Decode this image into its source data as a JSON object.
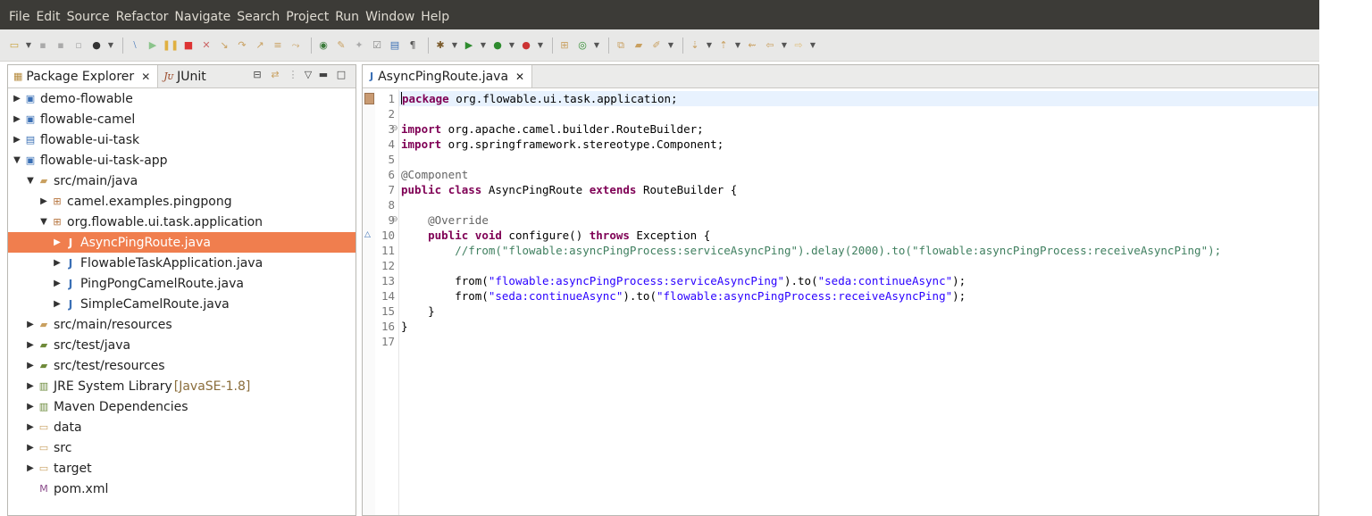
{
  "menu": {
    "items": [
      "File",
      "Edit",
      "Source",
      "Refactor",
      "Navigate",
      "Search",
      "Project",
      "Run",
      "Window",
      "Help"
    ]
  },
  "left_panel": {
    "tabs": [
      {
        "label": "Package Explorer",
        "icon": "package-explorer-icon"
      },
      {
        "label": "JUnit",
        "icon": "junit-icon"
      }
    ],
    "tree": [
      {
        "label": "demo-flowable",
        "indent": 0,
        "expanded": false,
        "icon": "maven-project-icon"
      },
      {
        "label": "flowable-camel",
        "indent": 0,
        "expanded": false,
        "icon": "maven-project-icon"
      },
      {
        "label": "flowable-ui-task",
        "indent": 0,
        "expanded": false,
        "icon": "project-folder-icon"
      },
      {
        "label": "flowable-ui-task-app",
        "indent": 0,
        "expanded": true,
        "icon": "maven-project-icon"
      },
      {
        "label": "src/main/java",
        "indent": 1,
        "expanded": true,
        "icon": "source-folder-icon"
      },
      {
        "label": "camel.examples.pingpong",
        "indent": 2,
        "expanded": false,
        "icon": "package-icon"
      },
      {
        "label": "org.flowable.ui.task.application",
        "indent": 2,
        "expanded": true,
        "icon": "package-icon"
      },
      {
        "label": "AsyncPingRoute.java",
        "indent": 3,
        "expanded": false,
        "icon": "java-file-icon",
        "selected": true
      },
      {
        "label": "FlowableTaskApplication.java",
        "indent": 3,
        "expanded": false,
        "icon": "java-file-icon"
      },
      {
        "label": "PingPongCamelRoute.java",
        "indent": 3,
        "expanded": false,
        "icon": "java-file-icon"
      },
      {
        "label": "SimpleCamelRoute.java",
        "indent": 3,
        "expanded": false,
        "icon": "java-file-icon"
      },
      {
        "label": "src/main/resources",
        "indent": 1,
        "expanded": false,
        "icon": "source-folder-icon"
      },
      {
        "label": "src/test/java",
        "indent": 1,
        "expanded": false,
        "icon": "test-source-folder-icon"
      },
      {
        "label": "src/test/resources",
        "indent": 1,
        "expanded": false,
        "icon": "test-source-folder-icon"
      },
      {
        "label": "JRE System Library",
        "decoration": "[JavaSE-1.8]",
        "indent": 1,
        "expanded": false,
        "icon": "library-icon"
      },
      {
        "label": "Maven Dependencies",
        "indent": 1,
        "expanded": false,
        "icon": "library-icon"
      },
      {
        "label": "data",
        "indent": 1,
        "expanded": false,
        "icon": "folder-icon"
      },
      {
        "label": "src",
        "indent": 1,
        "expanded": false,
        "icon": "folder-icon"
      },
      {
        "label": "target",
        "indent": 1,
        "expanded": false,
        "icon": "folder-icon"
      },
      {
        "label": "pom.xml",
        "indent": 1,
        "expanded": null,
        "icon": "xml-file-icon"
      }
    ]
  },
  "editor": {
    "tab_label": "AsyncPingRoute.java",
    "lines": [
      {
        "n": "1",
        "fold": "",
        "tokens": [
          [
            "kw",
            "package"
          ],
          [
            "pl",
            " org.flowable.ui.task.application;"
          ]
        ]
      },
      {
        "n": "2",
        "fold": "",
        "tokens": []
      },
      {
        "n": "3",
        "fold": "⊖",
        "tokens": [
          [
            "kw",
            "import"
          ],
          [
            "pl",
            " org.apache.camel.builder.RouteBuilder;"
          ]
        ]
      },
      {
        "n": "4",
        "fold": "",
        "tokens": [
          [
            "kw",
            "import"
          ],
          [
            "pl",
            " org.springframework.stereotype.Component;"
          ]
        ]
      },
      {
        "n": "5",
        "fold": "",
        "tokens": []
      },
      {
        "n": "6",
        "fold": "",
        "tokens": [
          [
            "an",
            "@Component"
          ]
        ]
      },
      {
        "n": "7",
        "fold": "",
        "tokens": [
          [
            "kw",
            "public"
          ],
          [
            "pl",
            " "
          ],
          [
            "kw",
            "class"
          ],
          [
            "pl",
            " AsyncPingRoute "
          ],
          [
            "kw",
            "extends"
          ],
          [
            "pl",
            " RouteBuilder {"
          ]
        ]
      },
      {
        "n": "8",
        "fold": "",
        "tokens": []
      },
      {
        "n": "9",
        "fold": "⊖",
        "tokens": [
          [
            "pl",
            "    "
          ],
          [
            "an",
            "@Override"
          ]
        ]
      },
      {
        "n": "10",
        "fold": "△",
        "tokens": [
          [
            "pl",
            "    "
          ],
          [
            "kw",
            "public"
          ],
          [
            "pl",
            " "
          ],
          [
            "kw",
            "void"
          ],
          [
            "pl",
            " configure() "
          ],
          [
            "kw",
            "throws"
          ],
          [
            "pl",
            " Exception {"
          ]
        ]
      },
      {
        "n": "11",
        "fold": "",
        "tokens": [
          [
            "pl",
            "        "
          ],
          [
            "cm",
            "//from(\"flowable:asyncPingProcess:serviceAsyncPing\").delay(2000).to(\"flowable:asyncPingProcess:receiveAsyncPing\");"
          ]
        ]
      },
      {
        "n": "12",
        "fold": "",
        "tokens": []
      },
      {
        "n": "13",
        "fold": "",
        "tokens": [
          [
            "pl",
            "        from("
          ],
          [
            "st",
            "\"flowable:asyncPingProcess:serviceAsyncPing\""
          ],
          [
            "pl",
            ").to("
          ],
          [
            "st",
            "\"seda:continueAsync\""
          ],
          [
            "pl",
            ");"
          ]
        ]
      },
      {
        "n": "14",
        "fold": "",
        "tokens": [
          [
            "pl",
            "        from("
          ],
          [
            "st",
            "\"seda:continueAsync\""
          ],
          [
            "pl",
            ").to("
          ],
          [
            "st",
            "\"flowable:asyncPingProcess:receiveAsyncPing\""
          ],
          [
            "pl",
            ");"
          ]
        ]
      },
      {
        "n": "15",
        "fold": "",
        "tokens": [
          [
            "pl",
            "    }"
          ]
        ]
      },
      {
        "n": "16",
        "fold": "",
        "tokens": [
          [
            "pl",
            "}"
          ]
        ]
      },
      {
        "n": "17",
        "fold": "",
        "tokens": []
      }
    ]
  }
}
